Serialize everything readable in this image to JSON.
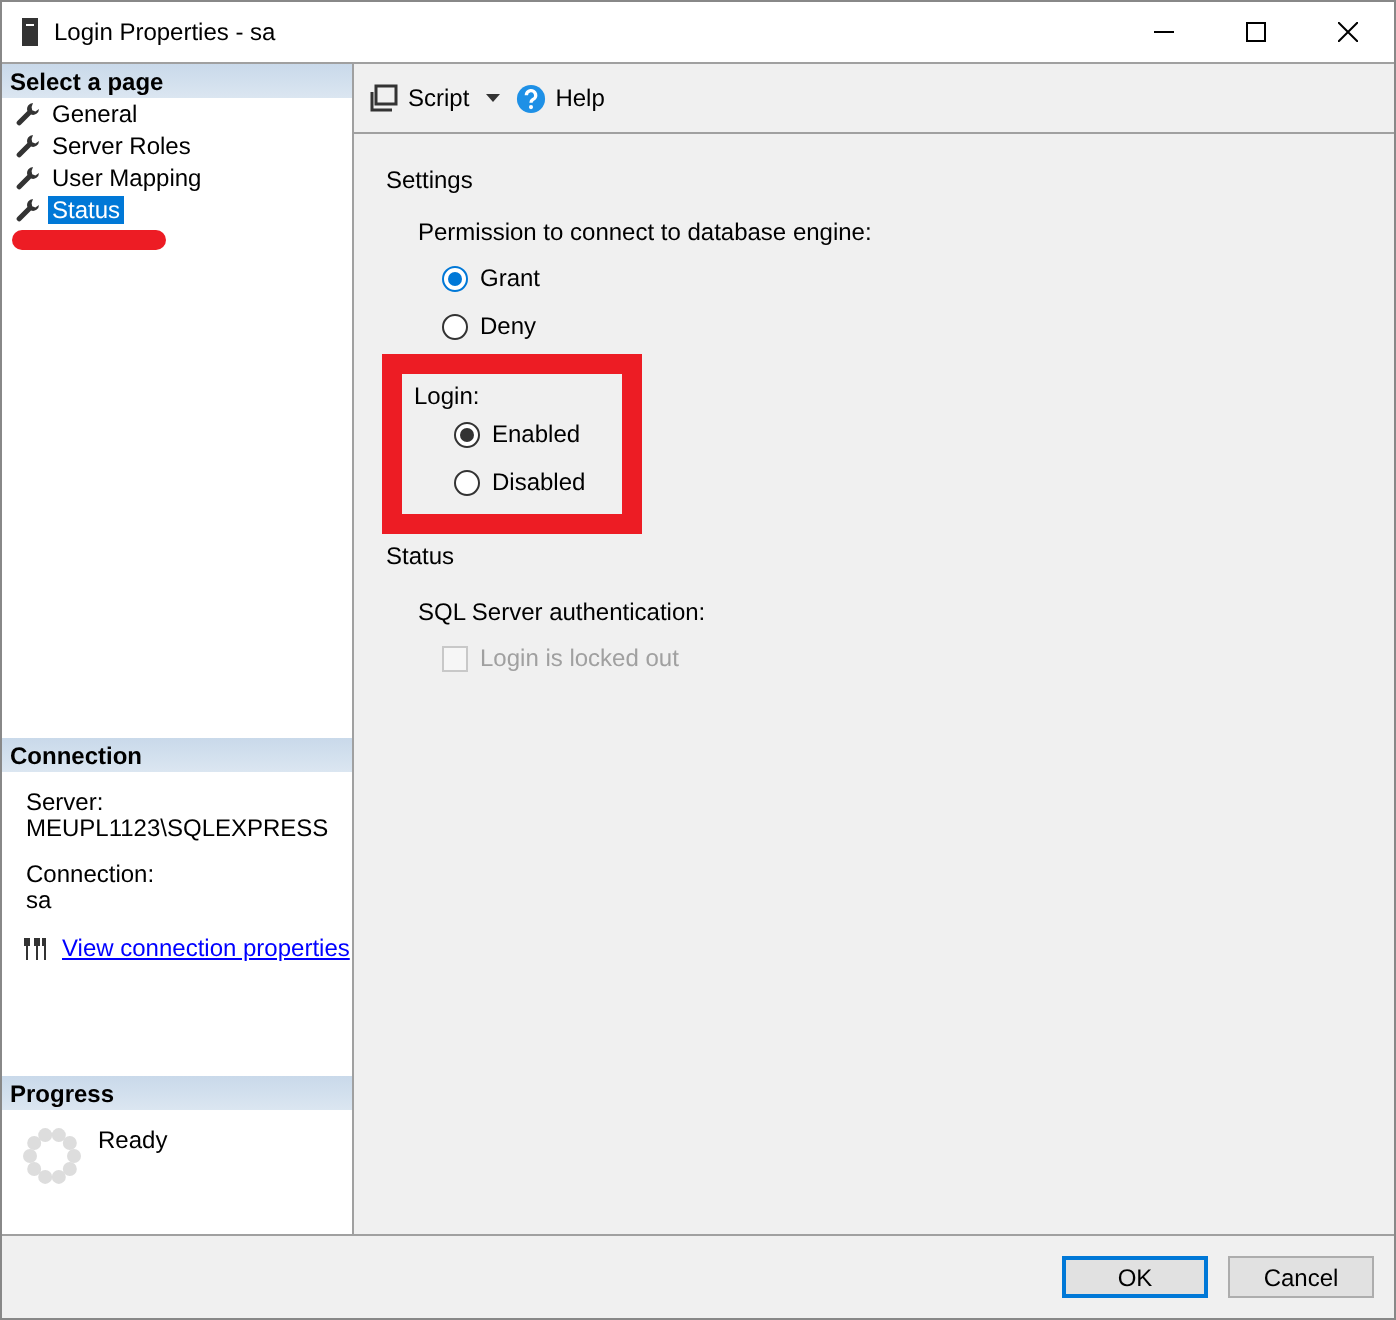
{
  "window": {
    "title": "Login Properties - sa"
  },
  "sidebar": {
    "header": "Select a page",
    "items": [
      {
        "label": "General",
        "selected": false
      },
      {
        "label": "Server Roles",
        "selected": false
      },
      {
        "label": "User Mapping",
        "selected": false
      },
      {
        "label": "Status",
        "selected": true
      }
    ]
  },
  "connection": {
    "header": "Connection",
    "server_label": "Server:",
    "server": "MEUPL1123\\SQLEXPRESS",
    "connection_label": "Connection:",
    "connection": "sa",
    "link": "View connection properties"
  },
  "progress": {
    "header": "Progress",
    "status": "Ready"
  },
  "toolbar": {
    "script": "Script",
    "help": "Help"
  },
  "settings": {
    "header": "Settings",
    "permission": {
      "label": "Permission to connect to database engine:",
      "options": [
        {
          "label": "Grant",
          "selected": true
        },
        {
          "label": "Deny",
          "selected": false
        }
      ]
    },
    "login": {
      "label": "Login:",
      "options": [
        {
          "label": "Enabled",
          "selected": true
        },
        {
          "label": "Disabled",
          "selected": false
        }
      ]
    }
  },
  "status": {
    "header": "Status",
    "auth_label": "SQL Server authentication:",
    "locked": {
      "label": "Login is locked out",
      "checked": false,
      "disabled": true
    }
  },
  "buttons": [
    {
      "label": "OK",
      "default": true
    },
    {
      "label": "Cancel",
      "default": false
    }
  ]
}
